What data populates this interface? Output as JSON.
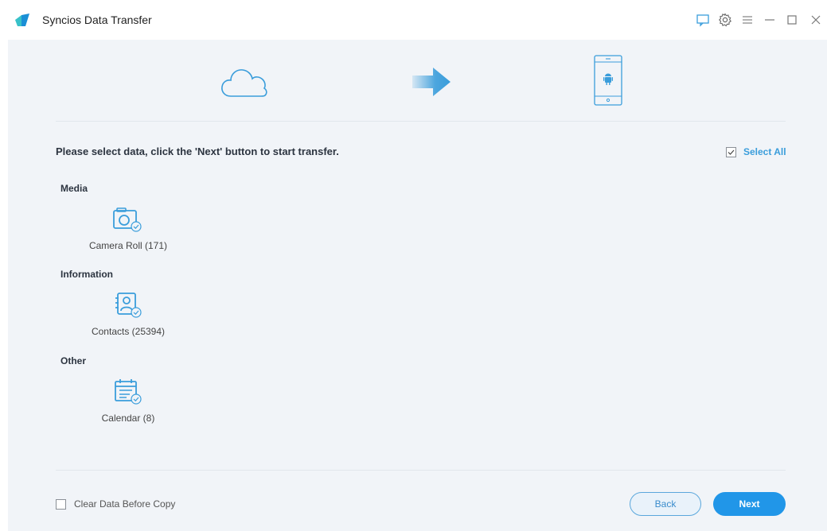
{
  "window": {
    "title": "Syncios Data Transfer",
    "controls": [
      "feedback-icon",
      "settings-icon",
      "menu-icon",
      "minimize-icon",
      "maximize-icon",
      "close-icon"
    ]
  },
  "transfer": {
    "source_icon": "cloud-icon",
    "direction_icon": "arrow-right-icon",
    "target_icon": "android-phone-icon"
  },
  "instruction": "Please select data, click the 'Next' button to start transfer.",
  "select_all": {
    "label": "Select All",
    "checked": true
  },
  "sections": [
    {
      "label": "Media",
      "items": [
        {
          "label": "Camera Roll (171)",
          "icon": "camera-icon",
          "checked": true
        }
      ]
    },
    {
      "label": "Information",
      "items": [
        {
          "label": "Contacts (25394)",
          "icon": "contacts-icon",
          "checked": true
        }
      ]
    },
    {
      "label": "Other",
      "items": [
        {
          "label": "Calendar (8)",
          "icon": "calendar-icon",
          "checked": true
        }
      ]
    }
  ],
  "footer": {
    "clear_data_label": "Clear Data Before Copy",
    "clear_data_checked": false,
    "back_label": "Back",
    "next_label": "Next"
  },
  "colors": {
    "accent": "#2196e8",
    "icon": "#3a9ddb",
    "background": "#f1f4f8"
  }
}
